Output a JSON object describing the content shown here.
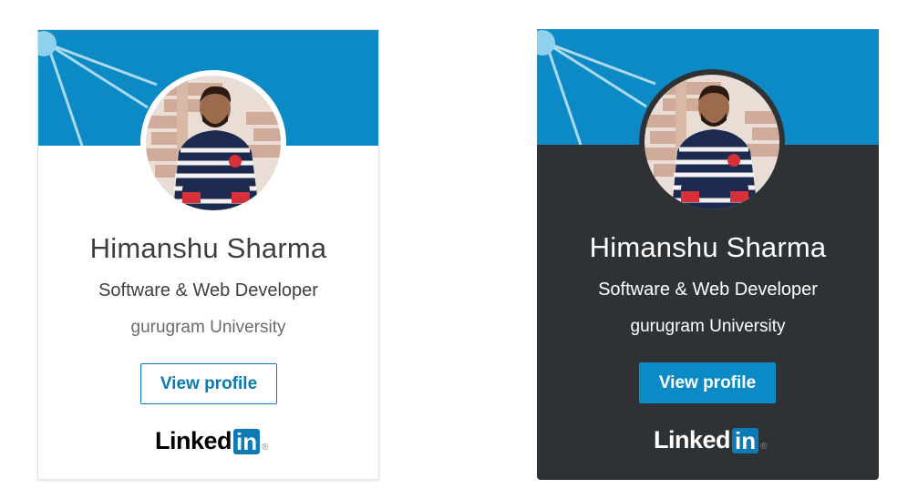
{
  "cards": [
    {
      "theme": "light",
      "name": "Himanshu Sharma",
      "headline": "Software & Web Developer",
      "school": "gurugram University",
      "button_label": "View profile",
      "logo": {
        "word": "Linked",
        "box": "in",
        "reg": "®"
      }
    },
    {
      "theme": "dark",
      "name": "Himanshu Sharma",
      "headline": "Software & Web Developer",
      "school": "gurugram University",
      "button_label": "View profile",
      "logo": {
        "word": "Linked",
        "box": "in",
        "reg": "®"
      }
    }
  ],
  "colors": {
    "brand_blue": "#0b8ac5",
    "dark_card": "#2f3235",
    "light_text": "#3f3f3f"
  }
}
